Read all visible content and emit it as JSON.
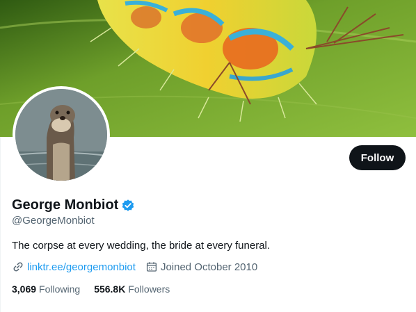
{
  "banner": {
    "description_icon": "caterpillar-banner-image"
  },
  "avatar": {
    "icon": "otter-avatar-image"
  },
  "actions": {
    "follow_label": "Follow"
  },
  "profile": {
    "display_name": "George Monbiot",
    "verified": true,
    "handle": "@GeorgeMonbiot",
    "bio": "The corpse at every wedding, the bride at every funeral.",
    "link_text": "linktr.ee/georgemonbiot",
    "joined": "Joined October 2010"
  },
  "stats": {
    "following_count": "3,069",
    "following_label": "Following",
    "followers_count": "556.8K",
    "followers_label": "Followers"
  },
  "colors": {
    "accent": "#1d9bf0",
    "text_primary": "#0f1419",
    "text_secondary": "#536471",
    "button_bg": "#0f1419"
  }
}
